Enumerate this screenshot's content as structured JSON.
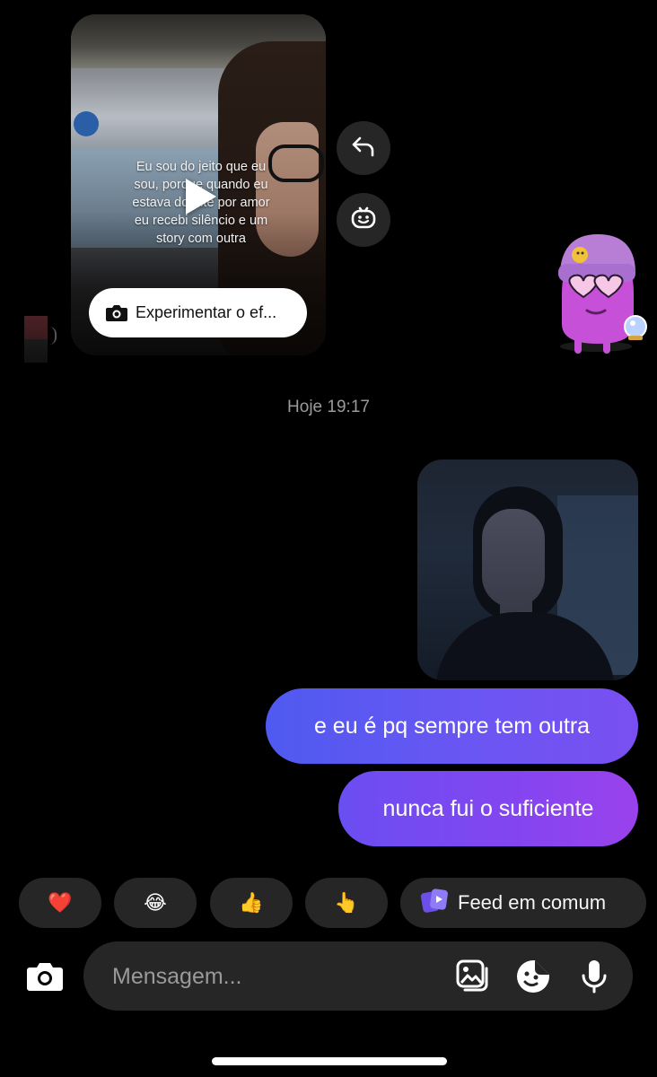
{
  "reel": {
    "caption": "Eu sou do jeito que eu\nsou, porque quando eu\nestava doente por amor\neu recebi silêncio e um\nstory com outra",
    "effect_button_label": "Experimentar o ef..."
  },
  "timestamp": "Hoje 19:17",
  "messages": [
    {
      "text": "e eu é pq sempre tem outra"
    },
    {
      "text": "nunca fui o suficiente"
    }
  ],
  "quick_replies": {
    "heart": "❤️",
    "laugh": "😂",
    "thumbs_up": "👍",
    "point": "👆",
    "feed_label": "Feed em comum"
  },
  "composer": {
    "placeholder": "Mensagem..."
  },
  "colors": {
    "bubble_start": "#4f5af0",
    "bubble_end": "#9a42ec",
    "chip_bg": "#262626"
  }
}
